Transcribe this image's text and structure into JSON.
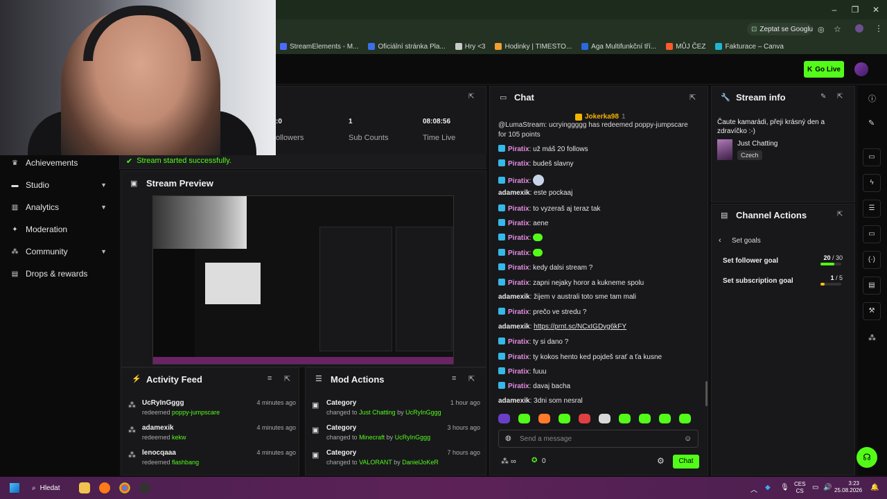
{
  "browser": {
    "gemini_label": "Zeptat se Googlu",
    "bookmarks": [
      {
        "label": "StreamElements - M...",
        "color": "#4b6bff"
      },
      {
        "label": "Oficiální stránka Pla...",
        "color": "#3d6fe8"
      },
      {
        "label": "Hry <3",
        "color": "#c9c9c9"
      },
      {
        "label": "Hodinky | TIMESTO...",
        "color": "#f0a030"
      },
      {
        "label": "Aga Multifunkční tří...",
        "color": "#2a6adf"
      },
      {
        "label": "MŮJ ČEZ",
        "color": "#ff5a2a"
      },
      {
        "label": "Fakturace – Canva",
        "color": "#1fb6d4"
      }
    ]
  },
  "header": {
    "go_live_label": "Go Live"
  },
  "sidebar": {
    "items": [
      {
        "label": "Achievements",
        "icon": "trophy-icon",
        "chevron": false
      },
      {
        "label": "Studio",
        "icon": "studio-icon",
        "chevron": true
      },
      {
        "label": "Analytics",
        "icon": "chart-icon",
        "chevron": true
      },
      {
        "label": "Moderation",
        "icon": "wrench-icon",
        "chevron": false
      },
      {
        "label": "Community",
        "icon": "community-icon",
        "chevron": true
      },
      {
        "label": "Drops & rewards",
        "icon": "drops-icon",
        "chevron": false
      }
    ]
  },
  "stats": {
    "followers_label": "ollowers",
    "followers_value": ":0",
    "sub_counts_value": "1",
    "sub_counts_label": "Sub Counts",
    "time_live_value": "08:08:56",
    "time_live_label": "Time Live"
  },
  "status": {
    "message": "Stream started successfully."
  },
  "preview": {
    "title": "Stream Preview"
  },
  "activity": {
    "title": "Activity Feed",
    "items": [
      {
        "user": "UcRyInGggg",
        "action": "redeemed",
        "reward": "poppy-jumpscare",
        "time": "4 minutes ago"
      },
      {
        "user": "adamexik",
        "action": "redeemed",
        "reward": "kekw",
        "time": "4 minutes ago"
      },
      {
        "user": "lenocqaaa",
        "action": "redeemed",
        "reward": "flashbang",
        "time": "4 minutes ago"
      }
    ]
  },
  "mod": {
    "title": "Mod Actions",
    "items": [
      {
        "title": "Category",
        "prefix": "changed to",
        "target": "Just Chatting",
        "by": "by",
        "user": "UcRyInGggg",
        "time": "1 hour ago"
      },
      {
        "title": "Category",
        "prefix": "changed to",
        "target": "Minecraft",
        "by": "by",
        "user": "UcRyInGggg",
        "time": "3 hours ago"
      },
      {
        "title": "Category",
        "prefix": "changed to",
        "target": "VALORANT",
        "by": "by",
        "user": "DanielJoKeR",
        "time": "7 hours ago"
      }
    ]
  },
  "chat": {
    "title": "Chat",
    "pinned_user": "Jokerka98",
    "pinned_count": "1",
    "redeem_line_1": "@LumaStream: ucryinggggg has redeemed poppy-jumpscare",
    "redeem_line_2": "for 105 points",
    "messages": [
      {
        "user": "Piratix",
        "text": "už máš 20 follows",
        "badge": true
      },
      {
        "user": "Piratix",
        "text": "budeš slavny",
        "badge": true
      },
      {
        "user": "Piratix",
        "text": "",
        "badge": true,
        "emote": "round"
      },
      {
        "user": "adamexik",
        "text": "este pockaaj",
        "badge": false
      },
      {
        "user": "Piratix",
        "text": "to vyzeraš aj teraz tak",
        "badge": true
      },
      {
        "user": "Piratix",
        "text": "aene",
        "badge": true
      },
      {
        "user": "Piratix",
        "text": "",
        "badge": true,
        "emote": "green"
      },
      {
        "user": "Piratix",
        "text": "",
        "badge": true,
        "emote": "green"
      },
      {
        "user": "Piratix",
        "text": "kedy dalsi stream ?",
        "badge": true
      },
      {
        "user": "Piratix",
        "text": "zapni nejaky horor a kukneme spolu",
        "badge": true
      },
      {
        "user": "adamexik",
        "text": "žijem v australi toto sme tam mali",
        "badge": false
      },
      {
        "user": "Piratix",
        "text": "prečo ve stredu ?",
        "badge": true
      },
      {
        "user": "adamexik",
        "text": "https://prnt.sc/NCxIGDyg6kFY",
        "badge": false,
        "link": true
      },
      {
        "user": "Piratix",
        "text": "ty si dano ?",
        "badge": true
      },
      {
        "user": "Piratix",
        "text": "ty kokos hento ked pojdeš srať a ťa kusne",
        "badge": true
      },
      {
        "user": "Piratix",
        "text": "fuuu",
        "badge": true
      },
      {
        "user": "Piratix",
        "text": "davaj bacha",
        "badge": true
      },
      {
        "user": "adamexik",
        "text": "3dni som nesral",
        "badge": false
      }
    ],
    "input_placeholder": "Send a message",
    "points_value": "0",
    "send_label": "Chat"
  },
  "stream_info": {
    "title": "Stream info",
    "description": "Čaute kamarádi, přeji krásný den a zdravíčko :-)",
    "category": "Just Chatting",
    "language": "Czech"
  },
  "channel_actions": {
    "title": "Channel Actions",
    "back_label": "Set goals",
    "goals": [
      {
        "label": "Set follower goal",
        "current": "20",
        "target": "/ 30",
        "fraction": 0.67,
        "color": "#53fc18"
      },
      {
        "label": "Set subscription goal",
        "current": "1",
        "target": "/ 5",
        "fraction": 0.2,
        "color": "#f5c400"
      }
    ]
  },
  "taskbar": {
    "search_label": "Hledat",
    "lang_top": "CES",
    "lang_bottom": "CS",
    "time": "3:23",
    "date": "25.08.2026"
  }
}
